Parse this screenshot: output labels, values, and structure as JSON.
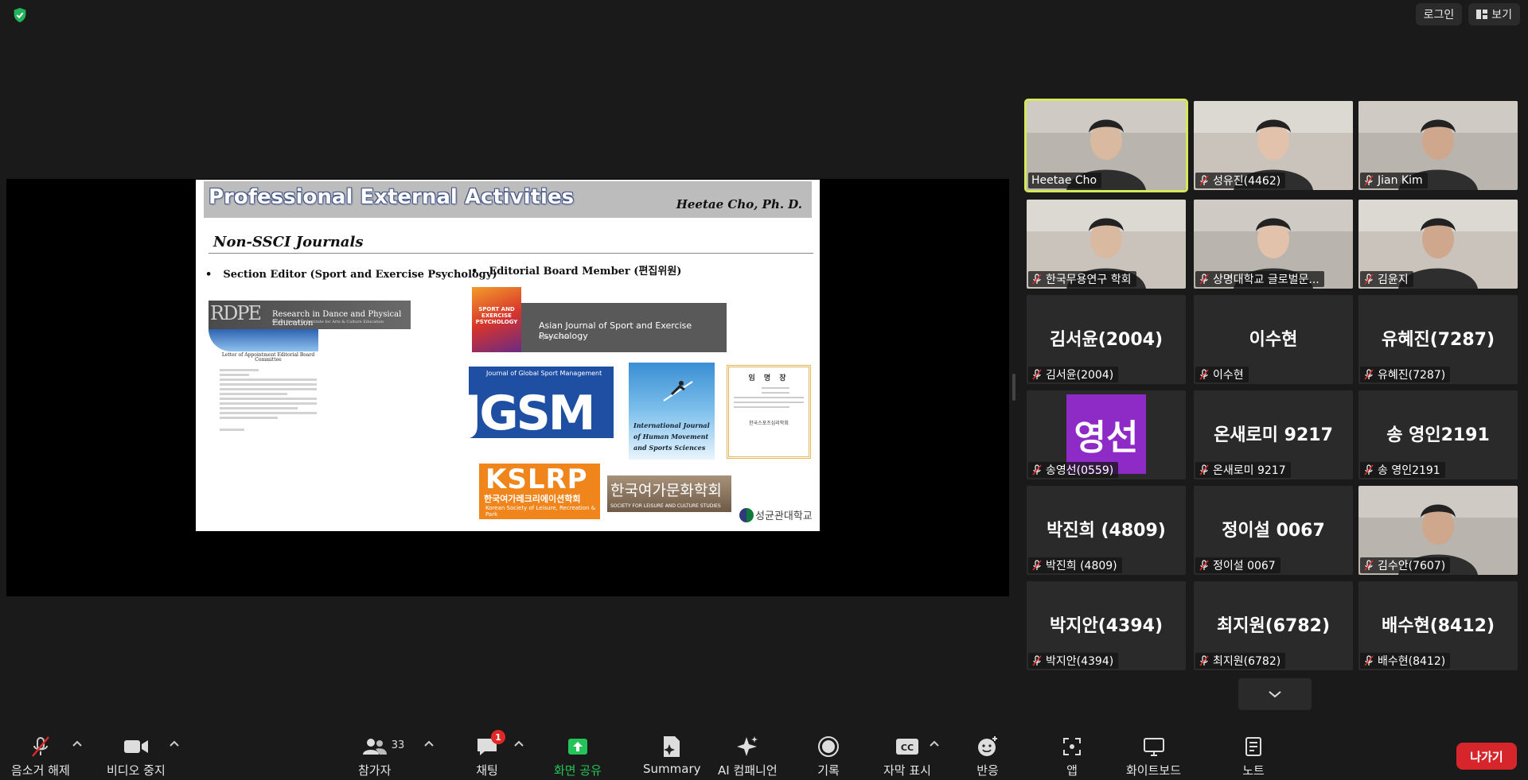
{
  "top_bar": {
    "login_label": "로그인",
    "view_label": "보기"
  },
  "slide": {
    "title": "Professional External Activities",
    "author": "Heetae Cho, Ph. D.",
    "subtitle": "Non-SSCI Journals",
    "bullet_left": "Section Editor (Sport and Exercise Psychology)",
    "bullet_right": "Editorial Board Member (편집위원)",
    "rdpe_logo": "RDPE",
    "rdpe_name": "Research in Dance and Physical Education",
    "rdpe_sub": "Global Research Institute for Arts & Culture Education",
    "letter_title": "Letter of Appointment Editorial Board Committee",
    "ajsep_cover": "SPORT AND EXERCISE PSYCHOLOGY",
    "ajsep_name": "Asian Journal of Sport and Exercise Psychology",
    "ajsep_sub": "Open access",
    "jgsm_small": "Journal of Global Sport Management",
    "jgsm_big": "JGSM",
    "ijhm": "International Journal of Human Movement and Sports Sciences",
    "cert_title": "임 명 장",
    "cert_footer": "한국스포츠심리학회",
    "kslrp_big": "KSLRP",
    "kslrp_ko": "한국여가레크리에이션학회",
    "kslrp_en": "Korean Society of Leisure, Recreation & Park",
    "kslcs_ko": "한국여가문화학회",
    "kslcs_en": "SOCIETY FOR LEISURE AND CULTURE STUDIES",
    "skku": "성균관대학교"
  },
  "participants": [
    {
      "label": "Heetae Cho",
      "big_name": "",
      "muted": false,
      "video": true,
      "active": true,
      "avatar": ""
    },
    {
      "label": "성유진(4462)",
      "big_name": "",
      "muted": true,
      "video": true,
      "active": false,
      "avatar": ""
    },
    {
      "label": "Jian Kim",
      "big_name": "",
      "muted": true,
      "video": true,
      "active": false,
      "avatar": ""
    },
    {
      "label": "한국무용연구 학회",
      "big_name": "",
      "muted": true,
      "video": true,
      "active": false,
      "avatar": ""
    },
    {
      "label": "상명대학교 글로벌문...",
      "big_name": "",
      "muted": true,
      "video": true,
      "active": false,
      "avatar": ""
    },
    {
      "label": "김윤지",
      "big_name": "",
      "muted": true,
      "video": true,
      "active": false,
      "avatar": ""
    },
    {
      "label": "김서윤(2004)",
      "big_name": "김서윤(2004)",
      "muted": true,
      "video": false,
      "active": false,
      "avatar": ""
    },
    {
      "label": "이수현",
      "big_name": "이수현",
      "muted": true,
      "video": false,
      "active": false,
      "avatar": ""
    },
    {
      "label": "유혜진(7287)",
      "big_name": "유혜진(7287)",
      "muted": true,
      "video": false,
      "active": false,
      "avatar": ""
    },
    {
      "label": "송영선(0559)",
      "big_name": "",
      "muted": true,
      "video": false,
      "active": false,
      "avatar": "영선"
    },
    {
      "label": "온새로미 9217",
      "big_name": "온새로미 9217",
      "muted": true,
      "video": false,
      "active": false,
      "avatar": ""
    },
    {
      "label": "송 영인2191",
      "big_name": "송 영인2191",
      "muted": true,
      "video": false,
      "active": false,
      "avatar": ""
    },
    {
      "label": "박진희 (4809)",
      "big_name": "박진희 (4809)",
      "muted": true,
      "video": false,
      "active": false,
      "avatar": ""
    },
    {
      "label": "정이설 0067",
      "big_name": "정이설 0067",
      "muted": true,
      "video": false,
      "active": false,
      "avatar": ""
    },
    {
      "label": "김수안(7607)",
      "big_name": "",
      "muted": true,
      "video": true,
      "active": false,
      "avatar": ""
    },
    {
      "label": "박지안(4394)",
      "big_name": "박지안(4394)",
      "muted": true,
      "video": false,
      "active": false,
      "avatar": ""
    },
    {
      "label": "최지원(6782)",
      "big_name": "최지원(6782)",
      "muted": true,
      "video": false,
      "active": false,
      "avatar": ""
    },
    {
      "label": "배수현(8412)",
      "big_name": "배수현(8412)",
      "muted": true,
      "video": false,
      "active": false,
      "avatar": ""
    }
  ],
  "toolbar": {
    "unmute": "음소거 해제",
    "stop_video": "비디오 중지",
    "participants": "참가자",
    "participants_count": "33",
    "chat": "채팅",
    "chat_badge": "1",
    "share_screen": "화면 공유",
    "summary": "Summary",
    "ai_companion": "AI 컴패니언",
    "record": "기록",
    "captions": "자막 표시",
    "reactions": "반응",
    "apps": "앱",
    "whiteboard": "화이트보드",
    "notes": "노트",
    "leave": "나가기"
  },
  "colors": {
    "active_speaker": "#d6e85c",
    "share_green": "#25c45a",
    "leave_red": "#d6262b",
    "mute_red": "#e02828"
  }
}
